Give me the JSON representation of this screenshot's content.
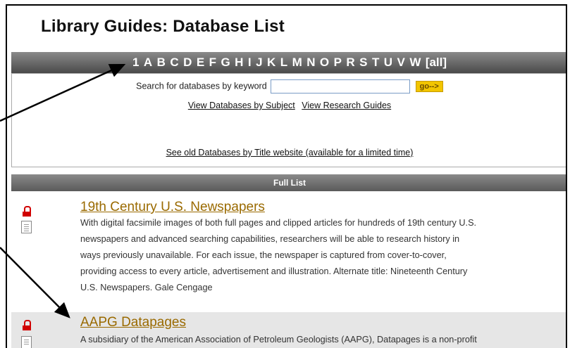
{
  "page": {
    "title": "Library Guides: Database List"
  },
  "alphabar": {
    "letters": [
      "1",
      "A",
      "B",
      "C",
      "D",
      "E",
      "F",
      "G",
      "H",
      "I",
      "J",
      "K",
      "L",
      "M",
      "N",
      "O",
      "P",
      "R",
      "S",
      "T",
      "U",
      "V",
      "W",
      "[all]"
    ]
  },
  "search": {
    "label": "Search for databases by keyword",
    "value": "",
    "button_label": "go-->"
  },
  "links": {
    "by_subject": "View Databases by Subject",
    "research_guides": "View Research Guides",
    "old_site": "See old Databases by Title website (available for a limited time)"
  },
  "list": {
    "header": "Full List",
    "entries": [
      {
        "title": "19th Century U.S. Newspapers",
        "desc_lines": [
          "With digital facsimile images of both full pages and clipped articles for hundreds of 19th century U.S.",
          "newspapers and advanced searching capabilities, researchers will be able to research history in",
          "ways previously unavailable. For each issue, the newspaper is captured from cover-to-cover,",
          "providing access to every article, advertisement and illustration.  Alternate title:  Nineteenth Century",
          "U.S. Newspapers.  Gale Cengage"
        ]
      },
      {
        "title": "AAPG Datapages",
        "desc_lines": [
          "A subsidiary of the American Association of Petroleum Geologists (AAPG), Datapages is a non-profit"
        ]
      }
    ]
  },
  "icons": {
    "restricted": "lock-icon",
    "details": "document-icon"
  },
  "colors": {
    "title_link": "#9a6a00",
    "lock": "#d00000",
    "bar": "#6a6a6a",
    "go_button": "#f2c500"
  }
}
